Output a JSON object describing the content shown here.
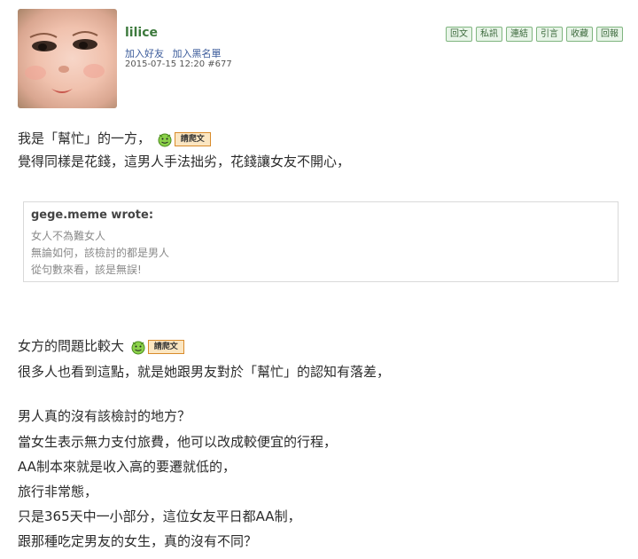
{
  "post": {
    "user_name": "lilice",
    "add_friend": "加入好友",
    "add_blacklist": "加入黑名單",
    "meta": "2015-07-15 12:20  #677"
  },
  "actions": [
    "回文",
    "私訊",
    "連結",
    "引言",
    "收藏",
    "回報"
  ],
  "tag_label": "請爬文",
  "lines": {
    "l1": "我是「幫忙」的一方，",
    "l2": "覺得同樣是花錢，這男人手法拙劣，花錢讓女友不開心，",
    "l3": "女方的問題比較大",
    "l4": "很多人也看到這點，就是她跟男友對於「幫忙」的認知有落差，",
    "l5": "男人真的沒有該檢討的地方？",
    "l6": "當女生表示無力支付旅費，他可以改成較便宜的行程，",
    "l7": "AA制本來就是收入高的要遷就低的，",
    "l8": "旅行非常態，",
    "l9": "只是365天中一小部分，這位女友平日都AA制，",
    "l10": "跟那種吃定男友的女生，真的沒有不同？"
  },
  "quote": {
    "author": "gege.meme wrote:",
    "lines": [
      "女人不為難女人",
      "無論如何，該檢討的都是男人",
      "從句數來看，該是無誤!"
    ]
  },
  "colors": {
    "username": "#3d7a3d",
    "link": "#3a5a9a",
    "button_bg": "#e8f4e8",
    "tag_bg": "#fbe6c2"
  }
}
